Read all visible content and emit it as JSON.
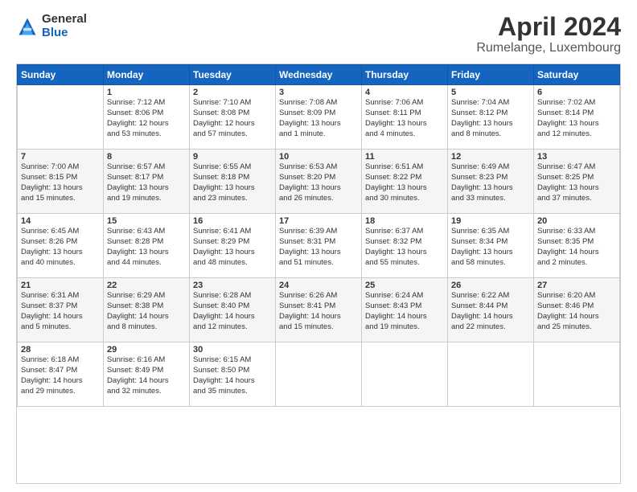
{
  "header": {
    "logo_general": "General",
    "logo_blue": "Blue",
    "month_title": "April 2024",
    "location": "Rumelange, Luxembourg"
  },
  "days_of_week": [
    "Sunday",
    "Monday",
    "Tuesday",
    "Wednesday",
    "Thursday",
    "Friday",
    "Saturday"
  ],
  "weeks": [
    [
      {
        "day": "",
        "sunrise": "",
        "sunset": "",
        "daylight": ""
      },
      {
        "day": "1",
        "sunrise": "Sunrise: 7:12 AM",
        "sunset": "Sunset: 8:06 PM",
        "daylight": "Daylight: 12 hours and 53 minutes."
      },
      {
        "day": "2",
        "sunrise": "Sunrise: 7:10 AM",
        "sunset": "Sunset: 8:08 PM",
        "daylight": "Daylight: 12 hours and 57 minutes."
      },
      {
        "day": "3",
        "sunrise": "Sunrise: 7:08 AM",
        "sunset": "Sunset: 8:09 PM",
        "daylight": "Daylight: 13 hours and 1 minute."
      },
      {
        "day": "4",
        "sunrise": "Sunrise: 7:06 AM",
        "sunset": "Sunset: 8:11 PM",
        "daylight": "Daylight: 13 hours and 4 minutes."
      },
      {
        "day": "5",
        "sunrise": "Sunrise: 7:04 AM",
        "sunset": "Sunset: 8:12 PM",
        "daylight": "Daylight: 13 hours and 8 minutes."
      },
      {
        "day": "6",
        "sunrise": "Sunrise: 7:02 AM",
        "sunset": "Sunset: 8:14 PM",
        "daylight": "Daylight: 13 hours and 12 minutes."
      }
    ],
    [
      {
        "day": "7",
        "sunrise": "Sunrise: 7:00 AM",
        "sunset": "Sunset: 8:15 PM",
        "daylight": "Daylight: 13 hours and 15 minutes."
      },
      {
        "day": "8",
        "sunrise": "Sunrise: 6:57 AM",
        "sunset": "Sunset: 8:17 PM",
        "daylight": "Daylight: 13 hours and 19 minutes."
      },
      {
        "day": "9",
        "sunrise": "Sunrise: 6:55 AM",
        "sunset": "Sunset: 8:18 PM",
        "daylight": "Daylight: 13 hours and 23 minutes."
      },
      {
        "day": "10",
        "sunrise": "Sunrise: 6:53 AM",
        "sunset": "Sunset: 8:20 PM",
        "daylight": "Daylight: 13 hours and 26 minutes."
      },
      {
        "day": "11",
        "sunrise": "Sunrise: 6:51 AM",
        "sunset": "Sunset: 8:22 PM",
        "daylight": "Daylight: 13 hours and 30 minutes."
      },
      {
        "day": "12",
        "sunrise": "Sunrise: 6:49 AM",
        "sunset": "Sunset: 8:23 PM",
        "daylight": "Daylight: 13 hours and 33 minutes."
      },
      {
        "day": "13",
        "sunrise": "Sunrise: 6:47 AM",
        "sunset": "Sunset: 8:25 PM",
        "daylight": "Daylight: 13 hours and 37 minutes."
      }
    ],
    [
      {
        "day": "14",
        "sunrise": "Sunrise: 6:45 AM",
        "sunset": "Sunset: 8:26 PM",
        "daylight": "Daylight: 13 hours and 40 minutes."
      },
      {
        "day": "15",
        "sunrise": "Sunrise: 6:43 AM",
        "sunset": "Sunset: 8:28 PM",
        "daylight": "Daylight: 13 hours and 44 minutes."
      },
      {
        "day": "16",
        "sunrise": "Sunrise: 6:41 AM",
        "sunset": "Sunset: 8:29 PM",
        "daylight": "Daylight: 13 hours and 48 minutes."
      },
      {
        "day": "17",
        "sunrise": "Sunrise: 6:39 AM",
        "sunset": "Sunset: 8:31 PM",
        "daylight": "Daylight: 13 hours and 51 minutes."
      },
      {
        "day": "18",
        "sunrise": "Sunrise: 6:37 AM",
        "sunset": "Sunset: 8:32 PM",
        "daylight": "Daylight: 13 hours and 55 minutes."
      },
      {
        "day": "19",
        "sunrise": "Sunrise: 6:35 AM",
        "sunset": "Sunset: 8:34 PM",
        "daylight": "Daylight: 13 hours and 58 minutes."
      },
      {
        "day": "20",
        "sunrise": "Sunrise: 6:33 AM",
        "sunset": "Sunset: 8:35 PM",
        "daylight": "Daylight: 14 hours and 2 minutes."
      }
    ],
    [
      {
        "day": "21",
        "sunrise": "Sunrise: 6:31 AM",
        "sunset": "Sunset: 8:37 PM",
        "daylight": "Daylight: 14 hours and 5 minutes."
      },
      {
        "day": "22",
        "sunrise": "Sunrise: 6:29 AM",
        "sunset": "Sunset: 8:38 PM",
        "daylight": "Daylight: 14 hours and 8 minutes."
      },
      {
        "day": "23",
        "sunrise": "Sunrise: 6:28 AM",
        "sunset": "Sunset: 8:40 PM",
        "daylight": "Daylight: 14 hours and 12 minutes."
      },
      {
        "day": "24",
        "sunrise": "Sunrise: 6:26 AM",
        "sunset": "Sunset: 8:41 PM",
        "daylight": "Daylight: 14 hours and 15 minutes."
      },
      {
        "day": "25",
        "sunrise": "Sunrise: 6:24 AM",
        "sunset": "Sunset: 8:43 PM",
        "daylight": "Daylight: 14 hours and 19 minutes."
      },
      {
        "day": "26",
        "sunrise": "Sunrise: 6:22 AM",
        "sunset": "Sunset: 8:44 PM",
        "daylight": "Daylight: 14 hours and 22 minutes."
      },
      {
        "day": "27",
        "sunrise": "Sunrise: 6:20 AM",
        "sunset": "Sunset: 8:46 PM",
        "daylight": "Daylight: 14 hours and 25 minutes."
      }
    ],
    [
      {
        "day": "28",
        "sunrise": "Sunrise: 6:18 AM",
        "sunset": "Sunset: 8:47 PM",
        "daylight": "Daylight: 14 hours and 29 minutes."
      },
      {
        "day": "29",
        "sunrise": "Sunrise: 6:16 AM",
        "sunset": "Sunset: 8:49 PM",
        "daylight": "Daylight: 14 hours and 32 minutes."
      },
      {
        "day": "30",
        "sunrise": "Sunrise: 6:15 AM",
        "sunset": "Sunset: 8:50 PM",
        "daylight": "Daylight: 14 hours and 35 minutes."
      },
      {
        "day": "",
        "sunrise": "",
        "sunset": "",
        "daylight": ""
      },
      {
        "day": "",
        "sunrise": "",
        "sunset": "",
        "daylight": ""
      },
      {
        "day": "",
        "sunrise": "",
        "sunset": "",
        "daylight": ""
      },
      {
        "day": "",
        "sunrise": "",
        "sunset": "",
        "daylight": ""
      }
    ]
  ]
}
